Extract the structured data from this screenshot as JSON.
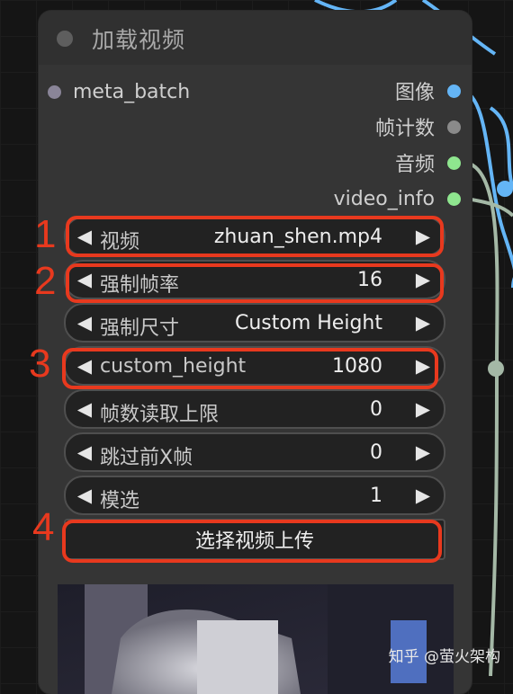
{
  "node": {
    "title": "加载视频",
    "input": "meta_batch",
    "outputs": [
      {
        "label": "图像",
        "color": "#64b5f6"
      },
      {
        "label": "帧计数",
        "color": "#8a8a8a"
      },
      {
        "label": "音频",
        "color": "#8fe68f"
      },
      {
        "label": "video_info",
        "color": "#8fe68f"
      }
    ]
  },
  "widgets": [
    {
      "label": "视频",
      "value": "zhuan_shen.mp4"
    },
    {
      "label": "强制帧率",
      "value": "16"
    },
    {
      "label": "强制尺寸",
      "value": "Custom Height"
    },
    {
      "label": "custom_height",
      "value": "1080"
    },
    {
      "label": "帧数读取上限",
      "value": "0"
    },
    {
      "label": "跳过前X帧",
      "value": "0"
    },
    {
      "label": "模选",
      "value": "1"
    }
  ],
  "upload_button": "选择视频上传",
  "annotations": [
    "1",
    "2",
    "3",
    "4"
  ],
  "watermark": "知乎 @萤火架构",
  "colors": {
    "annotation": "#e8391e",
    "wire_blue": "#64b5f6",
    "wire_sage": "#a4b8a6"
  }
}
